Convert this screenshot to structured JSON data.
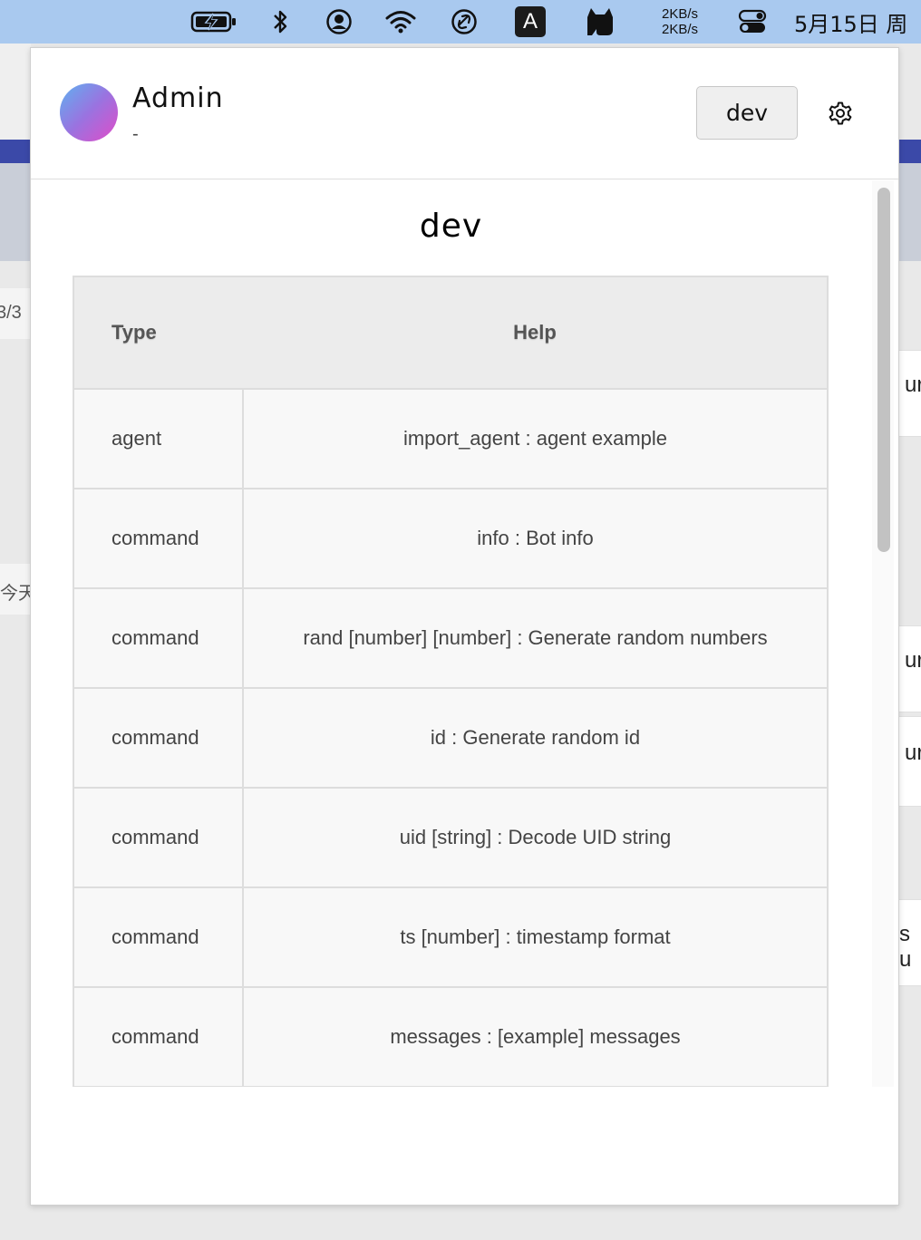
{
  "menubar": {
    "icons": [
      "battery-charging-icon",
      "bluetooth-icon",
      "user-circle-icon",
      "wifi-icon",
      "link-icon",
      "input-method-icon",
      "cat-icon",
      "control-center-icon"
    ],
    "input_method_label": "A",
    "net_up": "2KB/s",
    "net_down": "2KB/s",
    "clock": "5月15日 周"
  },
  "background": {
    "left_texts": [
      "3/3",
      "今天"
    ],
    "right_texts": [
      "ur",
      "ur",
      "ur",
      "s u"
    ]
  },
  "header": {
    "user_name": "Admin",
    "user_subtitle": "-",
    "env_button_label": "dev",
    "settings_icon": "gear-icon"
  },
  "main": {
    "title": "dev",
    "table": {
      "headers": {
        "type": "Type",
        "help": "Help"
      },
      "rows": [
        {
          "type": "agent",
          "help": "import_agent : agent example"
        },
        {
          "type": "command",
          "help": "info : Bot info"
        },
        {
          "type": "command",
          "help": "rand [number] [number] : Generate random numbers"
        },
        {
          "type": "command",
          "help": "id : Generate random id"
        },
        {
          "type": "command",
          "help": "uid [string] : Decode UID string"
        },
        {
          "type": "command",
          "help": "ts [number] : timestamp format"
        },
        {
          "type": "command",
          "help": "messages : [example] messages"
        }
      ]
    }
  },
  "colors": {
    "menubar_bg": "#a9c9ef",
    "header_th_bg": "#ececec",
    "row_bg": "#f8f8f8",
    "border": "#dddddd",
    "avatar_gradient": [
      "#5fb1f0",
      "#9a73e0",
      "#e04cc8"
    ]
  }
}
